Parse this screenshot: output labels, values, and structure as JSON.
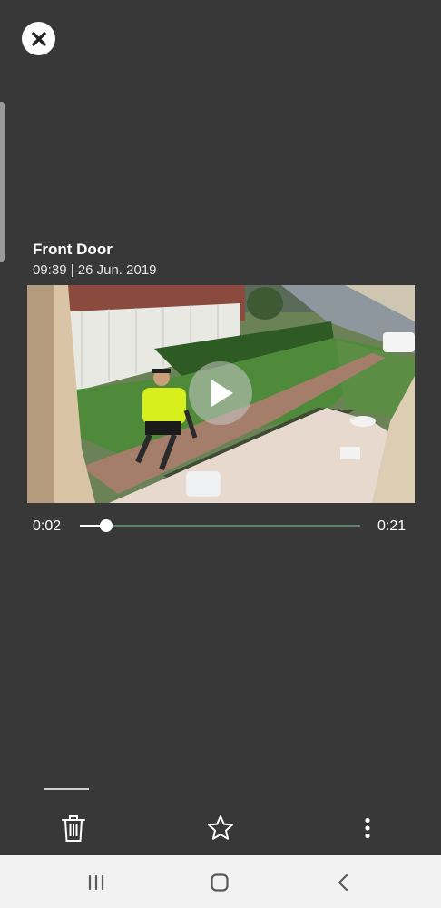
{
  "header": {
    "close_icon": "close-icon"
  },
  "event": {
    "title": "Front Door",
    "timestamp": "09:39 | 26 Jun. 2019"
  },
  "player": {
    "play_icon": "play-icon",
    "current_time": "0:02",
    "total_time": "0:21",
    "progress": 0.095
  },
  "actions": {
    "delete_icon": "trash-icon",
    "favorite_icon": "star-outline-icon",
    "more_icon": "more-vertical-icon"
  },
  "system_nav": {
    "recents_icon": "recents-icon",
    "home_icon": "home-icon",
    "back_icon": "back-icon"
  },
  "colors": {
    "background": "#383838",
    "seek_track": "#5e8470",
    "navbar": "#f2f2f2"
  }
}
